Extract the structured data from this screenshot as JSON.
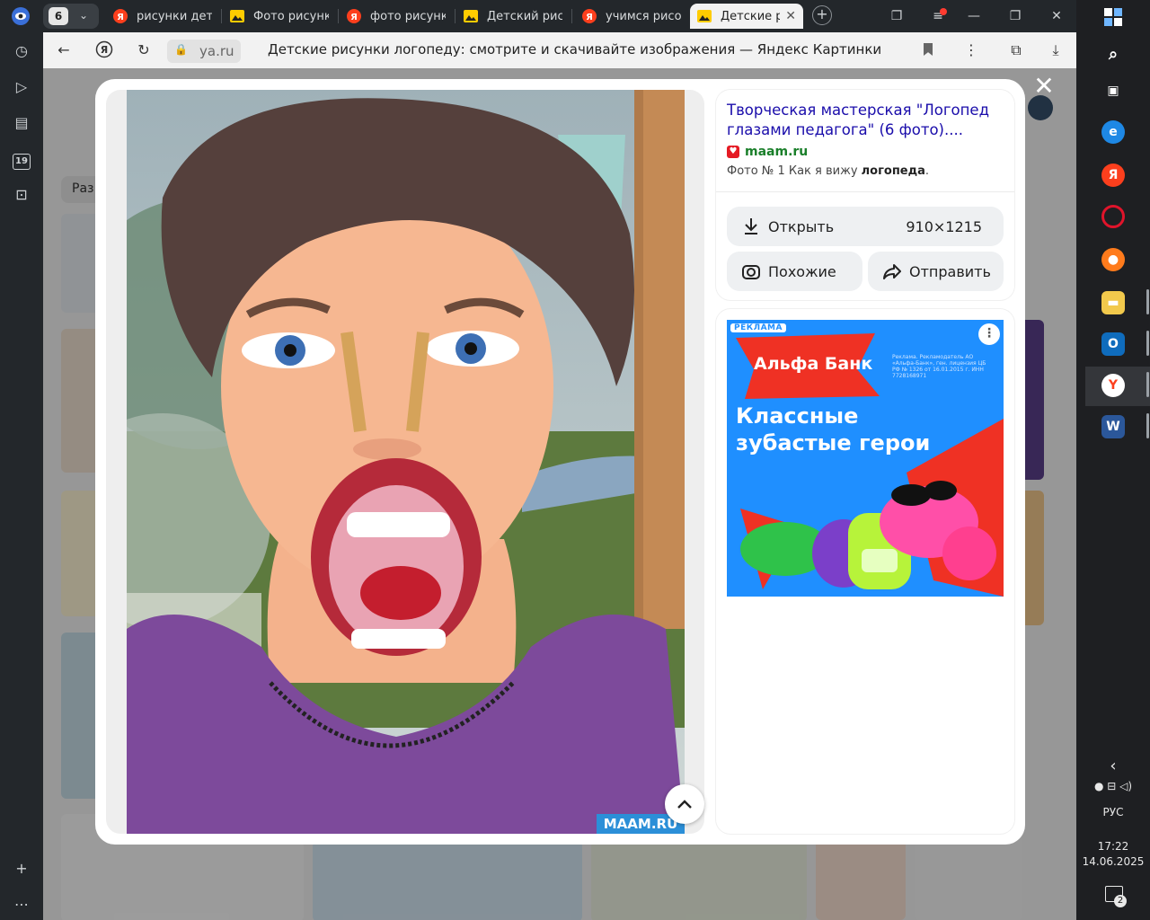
{
  "browser": {
    "tab_count": "6",
    "tabs": [
      {
        "label": "рисунки дете",
        "favicon": "yandex-icon"
      },
      {
        "label": "Фото рисунко",
        "favicon": "images-icon"
      },
      {
        "label": "фото рисунко",
        "favicon": "yandex-icon"
      },
      {
        "label": "Детский рису",
        "favicon": "images-icon"
      },
      {
        "label": "учимся рисов",
        "favicon": "yandex-icon"
      },
      {
        "label": "Детские ри",
        "favicon": "images-icon",
        "active": true
      }
    ],
    "address": {
      "domain": "ya.ru",
      "title": "Детские рисунки логопеду: смотрите и скачивайте изображения — Яндекс Картинки"
    },
    "sidebar_badge": "19"
  },
  "page": {
    "filter_label": "Раз"
  },
  "viewer": {
    "watermark": "MAAM.RU"
  },
  "info": {
    "title": "Творческая мастерская \"Логопед глазами педагога\" (6 фото)....",
    "source": "maam.ru",
    "caption_prefix": "Фото № 1 Как я вижу ",
    "caption_bold": "логопеда",
    "caption_suffix": ".",
    "open_label": "Открыть",
    "dimensions": "910×1215",
    "similar_label": "Похожие",
    "share_label": "Отправить"
  },
  "ad": {
    "label": "РЕКЛАМА",
    "brand": "Альфа Банк",
    "legal": "Рекламa. Рекламодатель АО «Альфа-Банк», ген. лицензия ЦБ РФ № 1326 от 16.01.2015 г. ИНН 7728168971",
    "headline_1": "Классные",
    "headline_2": "зубастые герои",
    "brand_color": "#ef3124",
    "bg_color": "#1f8fff"
  },
  "taskbar": {
    "language": "РУС",
    "time": "17:22",
    "date": "14.06.2025",
    "notifications": "2"
  }
}
